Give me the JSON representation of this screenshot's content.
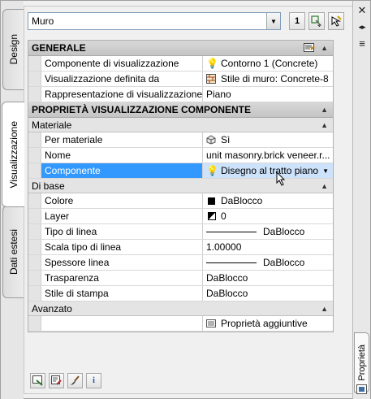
{
  "window": {
    "close_glyph": "✕",
    "dock_glyph": "◂▸",
    "menu_glyph": "≡",
    "side_label": "Proprietà"
  },
  "tabs": [
    {
      "label": "Design",
      "active": false
    },
    {
      "label": "Visualizzazione",
      "active": true
    },
    {
      "label": "Dati estesi",
      "active": false
    }
  ],
  "toolbar": {
    "object_type": "Muro",
    "btn_count": "1",
    "icons": [
      "quick-select-icon",
      "select-objects-icon",
      "toggle-pickadd-icon"
    ]
  },
  "sections": {
    "generale": {
      "title": "GENERALE",
      "rows": [
        {
          "name": "Componente di visualizzazione",
          "value": "Contorno 1 (Concrete)",
          "icon": "lightbulb-icon"
        },
        {
          "name": "Visualizzazione definita da",
          "value": "Stile di muro: Concrete-8",
          "icon": "wall-style-icon"
        },
        {
          "name": "Rappresentazione di visualizzazione",
          "value": "Piano",
          "icon": ""
        }
      ]
    },
    "proprieta": {
      "title": "PROPRIETÀ VISUALIZZAZIONE COMPONENTE"
    },
    "materiale": {
      "title": "Materiale",
      "rows": [
        {
          "name": "Per materiale",
          "value": "Sì",
          "icon": "material-icon"
        },
        {
          "name": "Nome",
          "value": "unit masonry.brick veneer.r...",
          "icon": ""
        },
        {
          "name": "Componente",
          "value": "Disegno al tratto piano",
          "icon": "lightbulb-icon"
        }
      ]
    },
    "di_base": {
      "title": "Di base",
      "rows": [
        {
          "name": "Colore",
          "value": "DaBlocco"
        },
        {
          "name": "Layer",
          "value": "0"
        },
        {
          "name": "Tipo di linea",
          "value": "DaBlocco"
        },
        {
          "name": "Scala tipo di linea",
          "value": "1.00000"
        },
        {
          "name": "Spessore linea",
          "value": "DaBlocco"
        },
        {
          "name": "Trasparenza",
          "value": "DaBlocco"
        },
        {
          "name": "Stile di stampa",
          "value": "DaBlocco"
        }
      ]
    },
    "avanzato": {
      "title": "Avanzato",
      "rows": [
        {
          "name": "",
          "value": "Proprietà aggiuntive"
        }
      ]
    }
  },
  "colors": {
    "selected_name_bg": "#3399ff",
    "selected_value_bg": "#cde3fb",
    "category_bg": "#c8c8c8"
  }
}
